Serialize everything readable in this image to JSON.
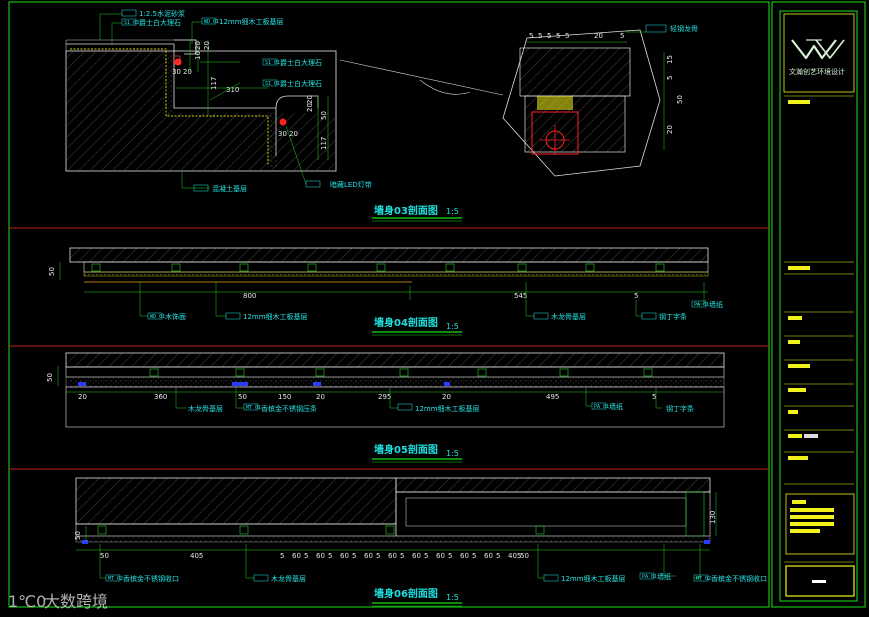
{
  "colors": {
    "background": "#000000",
    "frame_green": "#17e017",
    "divider_red": "#c21e1e",
    "cyan": "#24e3e3",
    "yellow": "#f2f21a",
    "dim_white": "#e8e8e8",
    "leader_green": "#20d020",
    "hatch": "#7a7a7a",
    "red_mark": "#ff2020"
  },
  "section1": {
    "title": "墙身03剖面图",
    "scale": "1:5",
    "tags": [
      "S1 03",
      "WD 01",
      "S1 01",
      "S1 01"
    ],
    "labels": {
      "top_a": "1:2.5水泥砂浆",
      "top_b": "爵士白大理石",
      "top_c": "12mm细木工板基层",
      "mid_a": "爵士白大理石",
      "mid_b": "爵士白大理石",
      "bottom_a": "混凝土基层",
      "bottom_b": "暗藏LED灯带"
    },
    "dims": [
      "20",
      "10",
      "20",
      "30",
      "20",
      "117",
      "310",
      "20",
      "20",
      "50",
      "30",
      "20",
      "117"
    ]
  },
  "detail": {
    "label": "轻钢龙骨",
    "dims_top": [
      "5",
      "5",
      "5",
      "5",
      "5",
      "20",
      "5"
    ],
    "dims_right": [
      "15",
      "5",
      "50",
      "20"
    ]
  },
  "section2": {
    "title": "墙身04剖面图",
    "scale": "1:5",
    "tags": [
      "WD 01",
      "PA 01"
    ],
    "labels": {
      "a": "木饰面",
      "b": "12mm细木工板基层",
      "c": "木龙骨基层",
      "d": "钢丁字条",
      "e": "墙纸"
    },
    "dims": [
      "50",
      "800",
      "545",
      "5"
    ]
  },
  "section3": {
    "title": "墙身05剖面图",
    "scale": "1:5",
    "tags": [
      "MT 01",
      "PA 01"
    ],
    "labels": {
      "a": "木龙骨基层",
      "b": "香槟金不锈钢压条",
      "c": "12mm细木工板基层",
      "d": "墙纸",
      "e": "钢丁字条"
    },
    "dims": [
      "50",
      "20",
      "360",
      "50",
      "150",
      "20",
      "295",
      "20",
      "495",
      "5"
    ]
  },
  "section4": {
    "title": "墙身06剖面图",
    "scale": "1:5",
    "tags": [
      "MT 02",
      "PA 01",
      "MT 02"
    ],
    "labels": {
      "a": "香槟金不锈钢收口",
      "b": "木龙骨基层",
      "c": "12mm细木工板基层",
      "d": "墙纸",
      "e": "香槟金不锈钢收口"
    },
    "dims": [
      "50",
      "130",
      "50",
      "405",
      "5",
      "60",
      "5",
      "60",
      "5",
      "60",
      "5",
      "60",
      "5",
      "60",
      "5",
      "60",
      "5",
      "60",
      "5",
      "60",
      "5",
      "60",
      "5",
      "405",
      "50"
    ]
  },
  "title_block": {
    "logo_text": "文瀚创艺环境设计"
  },
  "watermark": {
    "text": "大数跨境",
    "mark": "1℃0"
  }
}
